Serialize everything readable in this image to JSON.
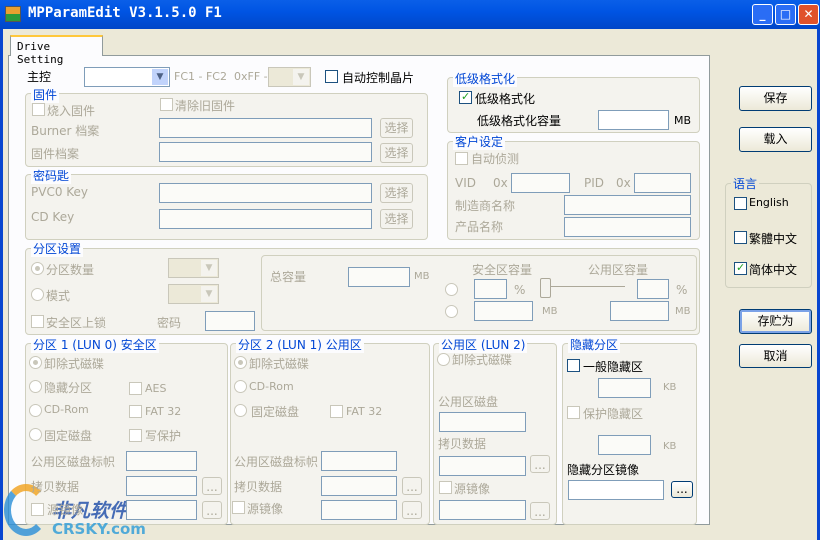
{
  "window": {
    "title": "MPParamEdit V3.1.5.0 F1",
    "minimize": "_",
    "maximize": "□",
    "close": "✕"
  },
  "tab": "Drive Setting",
  "controller": {
    "label": "主控",
    "range": "FC1 - FC2",
    "hex_prefix": "0xFF -",
    "auto_label": "自动控制晶片",
    "auto_checked": false
  },
  "firmware": {
    "title": "固件",
    "burn": "烧入固件",
    "clear": "清除旧固件",
    "burner_label": "Burner 档案",
    "fw_label": "固件档案",
    "select": "选择"
  },
  "key": {
    "title": "密码匙",
    "pvc0": "PVC0 Key",
    "cd": "CD Key",
    "select": "选择"
  },
  "lowformat": {
    "title": "低级格式化",
    "check": "低级格式化",
    "checked": true,
    "capacity": "低级格式化容量",
    "unit": "MB"
  },
  "customer": {
    "title": "客户设定",
    "auto": "自动侦测",
    "vid": "VID",
    "pid": "PID",
    "hex": "0x",
    "vendor": "制造商名称",
    "product": "产品名称"
  },
  "partition": {
    "title": "分区设置",
    "count": "分区数量",
    "mode": "模式",
    "lock": "安全区上锁",
    "password": "密码",
    "total": "总容量",
    "mb": "MB",
    "secure_cap": "安全区容量",
    "public_cap": "公用区容量",
    "percent": "%"
  },
  "p1": {
    "title": "分区 1 (LUN 0) 安全区",
    "removable": "卸除式磁碟",
    "hidden": "隐藏分区",
    "cdrom": "CD-Rom",
    "fixed": "固定磁盘",
    "aes": "AES",
    "fat32": "FAT 32",
    "wp": "写保护",
    "label": "公用区磁盘标帜",
    "copy": "拷贝数据",
    "mirror": "源镜像",
    "browse": "..."
  },
  "p2": {
    "title": "分区 2 (LUN 1) 公用区",
    "removable": "卸除式磁碟",
    "cdrom": "CD-Rom",
    "fixed": "固定磁盘",
    "fat32": "FAT 32",
    "label": "公用区磁盘标帜",
    "copy": "拷贝数据",
    "mirror": "源镜像",
    "browse": "..."
  },
  "p3": {
    "title": "公用区 (LUN 2)",
    "removable": "卸除式磁碟",
    "disk": "公用区磁盘",
    "copy": "拷贝数据",
    "mirror": "源镜像",
    "browse": "..."
  },
  "hidden": {
    "title": "隐藏分区",
    "general": "一般隐藏区",
    "kb": "KB",
    "protect": "保护隐藏区",
    "image": "隐藏分区镜像",
    "browse": "..."
  },
  "buttons": {
    "save": "保存",
    "load": "载入",
    "save_as": "存贮为",
    "cancel": "取消"
  },
  "language": {
    "title": "语言",
    "english": "English",
    "traditional": "繁體中文",
    "simplified": "简体中文",
    "selected": "简体中文"
  },
  "watermark": {
    "cn": "非凡软件站",
    "en": "CRSKY.com"
  }
}
